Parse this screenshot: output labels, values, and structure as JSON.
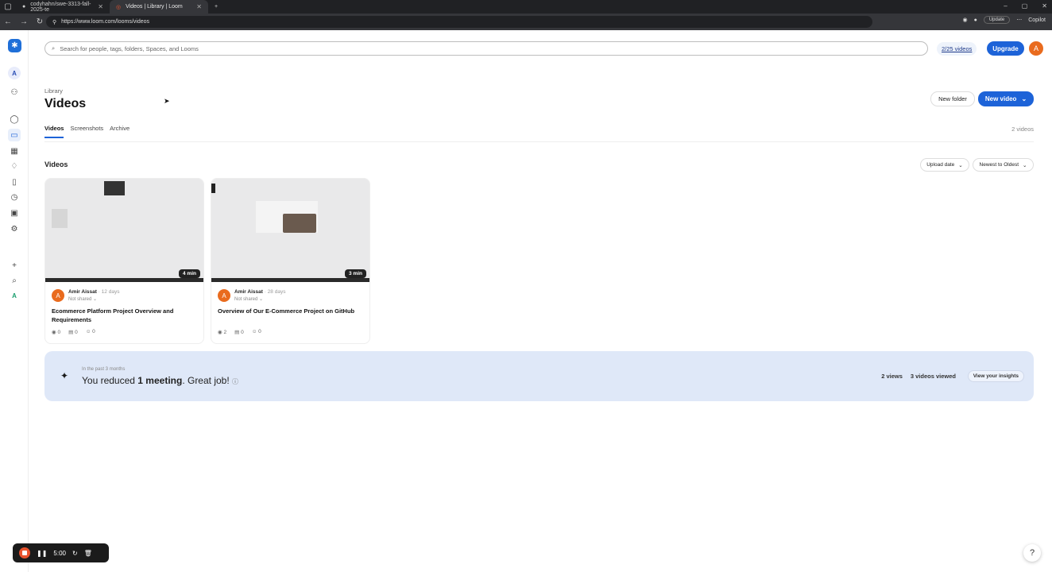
{
  "browser": {
    "tabs": [
      {
        "title": "codyhahn/swe-3313-fall-2025-te",
        "active": false
      },
      {
        "title": "Videos | Library | Loom",
        "active": true
      }
    ],
    "new_tab": "+",
    "url": "https://www.loom.com/looms/videos",
    "update_label": "Update",
    "copilot_label": "Copilot"
  },
  "topbar": {
    "search_placeholder": "Search for people, tags, folders, Spaces, and Looms",
    "video_quota": "2/25 videos",
    "upgrade_label": "Upgrade",
    "avatar_initial": "A"
  },
  "sidebar": {
    "workspace_initial": "A",
    "bottom_initial": "A"
  },
  "page": {
    "breadcrumb": "Library",
    "title": "Videos",
    "new_folder_label": "New folder",
    "new_video_label": "New video",
    "tabs": [
      "Videos",
      "Screenshots",
      "Archive"
    ],
    "count": "2 videos",
    "section_title": "Videos",
    "sort_field": "Upload date",
    "sort_order": "Newest to Oldest"
  },
  "videos": [
    {
      "duration": "4 min",
      "author_initial": "A",
      "author": "Amir Aissat",
      "ago": "· 12 days",
      "shared": "Not shared",
      "title": "Ecommerce Platform Project Overview and Requirements",
      "views": "0",
      "comments": "0",
      "reactions": "0"
    },
    {
      "duration": "3 min",
      "author_initial": "A",
      "author": "Amir Aissat",
      "ago": "· 28 days",
      "shared": "Not shared",
      "title": "Overview of Our E-Commerce Project on GitHub",
      "views": "2",
      "comments": "0",
      "reactions": "0"
    }
  ],
  "insights": {
    "period": "In the past 3 months",
    "text_prefix": "You reduced ",
    "text_bold": "1 meeting",
    "text_suffix": ". Great job!",
    "views": "2 views",
    "videos_viewed": "3 videos viewed",
    "button": "View your insights"
  },
  "recorder": {
    "time": "5:00"
  },
  "help_label": "?"
}
